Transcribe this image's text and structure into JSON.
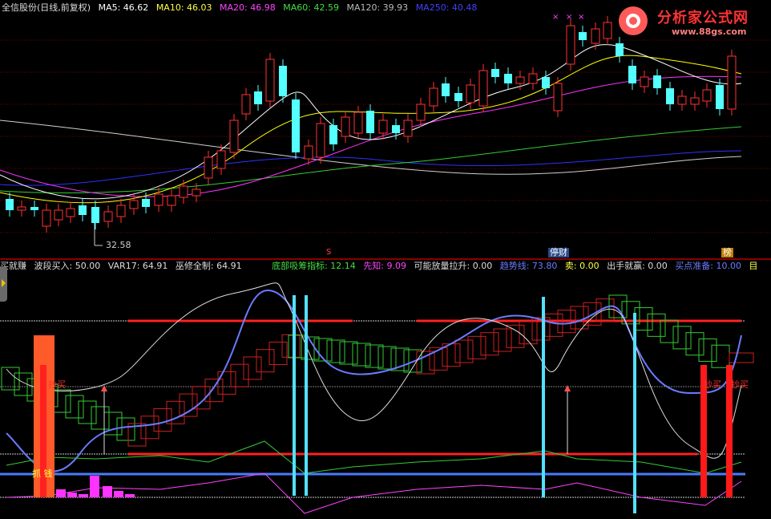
{
  "top_bar": {
    "stock": "全信股份(日线,前复权)",
    "ma5": "MA5: 46.62",
    "ma10": "MA10: 46.03",
    "ma20": "MA20: 46.98",
    "ma60": "MA60: 42.59",
    "ma120": "MA120: 39.93",
    "ma250": "MA250: 40.48"
  },
  "watermark": {
    "brand": "分析家公式网",
    "url": "www.88gs.com"
  },
  "low_label": "32.58",
  "flags": {
    "s": "S",
    "tingcai": "停财",
    "bang": "榜"
  },
  "bottom_bar": {
    "name": "买就赚",
    "bdmr": "波段买入: 50.00",
    "var17": "VAR17: 64.91",
    "wxqz": "巫修全制: 64.91",
    "dbcm": "底部吸筹指标: 12.14",
    "xz": "先知: 9.09",
    "kn": "可能放量拉升: 0.00",
    "qsx": "趋势线: 73.80",
    "mai": "卖: 0.00",
    "csjy": "出手就赢: 0.00",
    "mdzb": "买点准备: 10.00",
    "tail": "目"
  },
  "signals": {
    "buy1": "抄买",
    "buy2": "抄买",
    "buy3": "抄买",
    "zhua": "抓 钱"
  },
  "colors": {
    "up": "#ff3232",
    "down": "#54ffff",
    "ma5": "#ffffff",
    "ma10": "#ffff00",
    "ma20": "#ff33ff",
    "ma60": "#33cc33",
    "ma120": "#3030ff",
    "ma250": "#d0d0d0"
  }
}
